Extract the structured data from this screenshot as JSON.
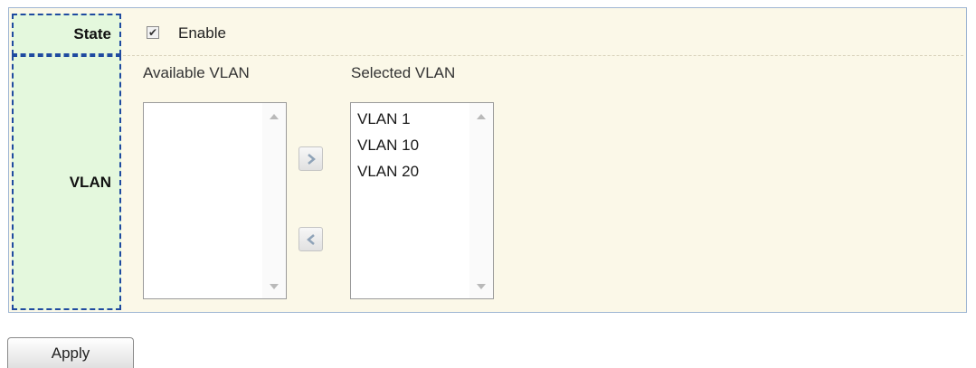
{
  "form": {
    "state_label": "State",
    "state_checked": true,
    "state_option": "Enable",
    "vlan_label": "VLAN"
  },
  "available": {
    "header": "Available VLAN",
    "items": []
  },
  "selected": {
    "header": "Selected VLAN",
    "items": [
      "VLAN 1",
      "VLAN 10",
      "VLAN 20"
    ]
  },
  "buttons": {
    "apply": "Apply",
    "add_icon": "chevron-right-icon",
    "remove_icon": "chevron-left-icon"
  },
  "colors": {
    "panel_bg": "#fbf8e8",
    "label_bg": "#e4f8dd",
    "label_border": "#1f4ba0"
  }
}
